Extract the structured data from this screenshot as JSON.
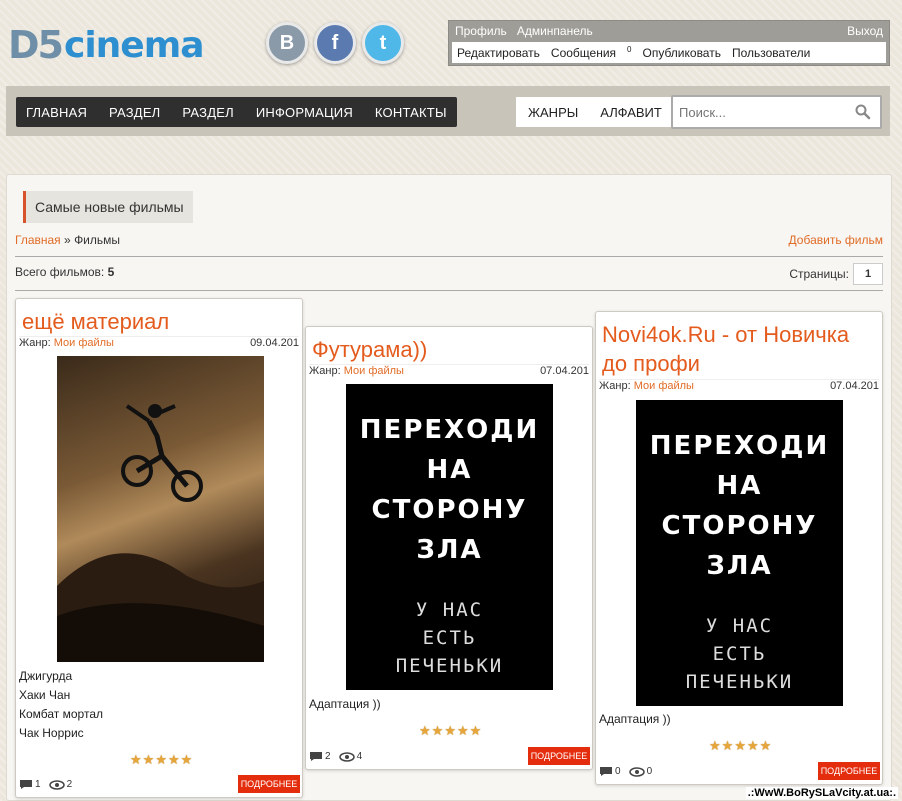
{
  "logo": {
    "part1": "D5",
    "part2": "cinema"
  },
  "social": [
    {
      "label": "B",
      "icon": "vk-icon"
    },
    {
      "label": "f",
      "icon": "facebook-icon"
    },
    {
      "label": "t",
      "icon": "twitter-icon"
    }
  ],
  "userpanel": {
    "profile": "Профиль",
    "admin": "Админпанель",
    "logout": "Выход",
    "edit": "Редактировать",
    "messages": "Сообщения",
    "messages_count": "0",
    "publish": "Опубликовать",
    "users": "Пользователи"
  },
  "nav": {
    "items": [
      "ГЛАВНАЯ",
      "РАЗДЕЛ",
      "РАЗДЕЛ",
      "ИНФОРМАЦИЯ",
      "КОНТАКТЫ"
    ],
    "alt": [
      "ЖАНРЫ",
      "АЛФАВИТ"
    ],
    "search_placeholder": "Поиск..."
  },
  "section": {
    "title": "Самые новые фильмы",
    "crumb_home": "Главная",
    "crumb_sep": "»",
    "crumb_current": "Фильмы",
    "add": "Добавить фильм",
    "total_label": "Всего фильмов:",
    "total_value": "5",
    "pages_label": "Страницы:",
    "page_current": "1"
  },
  "films": [
    {
      "title": "ещё материал",
      "genre_label": "Жанр:",
      "genre": "Мои файлы",
      "date": "09.04.201",
      "desc": [
        "Джигурда",
        "Хаки Чан",
        "Комбат мортал",
        "Чак Норрис"
      ],
      "rating": 5,
      "more": "ПОДРОБНЕЕ",
      "comments": "1",
      "views": "2"
    },
    {
      "title": "Футурама))",
      "genre_label": "Жанр:",
      "genre": "Мои файлы",
      "date": "07.04.201",
      "poster_text": [
        "ПЕРЕХОДИ",
        "НА",
        "СТОРОНУ",
        "ЗЛА"
      ],
      "poster_small": [
        "У НАС",
        "ЕСТЬ",
        "ПЕЧЕНЬКИ"
      ],
      "desc": [
        "Адаптация ))"
      ],
      "rating": 5,
      "more": "ПОДРОБНЕЕ",
      "comments": "2",
      "views": "4"
    },
    {
      "title": "Novi4ok.Ru - от Новичка до профи",
      "genre_label": "Жанр:",
      "genre": "Мои файлы",
      "date": "07.04.201",
      "poster_text": [
        "ПЕРЕХОДИ",
        "НА",
        "СТОРОНУ",
        "ЗЛА"
      ],
      "poster_small": [
        "У НАС",
        "ЕСТЬ",
        "ПЕЧЕНЬКИ"
      ],
      "desc": [
        "Адаптация ))"
      ],
      "rating": 5,
      "more": "ПОДРОБНЕЕ",
      "comments": "0",
      "views": "0"
    }
  ],
  "watermark": ".:WwW.BoRySLaVcity.at.ua:."
}
